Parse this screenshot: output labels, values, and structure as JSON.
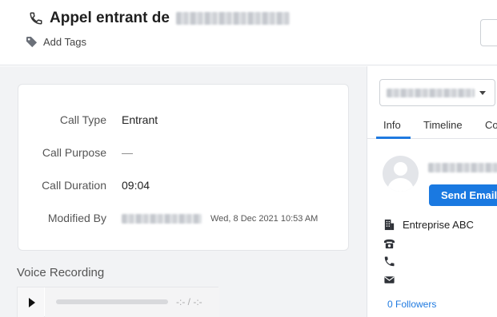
{
  "header": {
    "title": "Appel entrant de",
    "add_tags_label": "Add Tags"
  },
  "details": {
    "fields": [
      {
        "label": "Call Type",
        "value": "Entrant"
      },
      {
        "label": "Call Purpose",
        "value": "—"
      },
      {
        "label": "Call Duration",
        "value": "09:04"
      },
      {
        "label": "Modified By",
        "value": "Wed, 8 Dec 2021 10:53 AM"
      }
    ]
  },
  "voice_recording": {
    "heading": "Voice Recording",
    "time": "-:- / -:-"
  },
  "sidebar": {
    "tabs": [
      "Info",
      "Timeline",
      "Co"
    ],
    "active_tab": "Info",
    "send_email_label": "Send Email",
    "company": "Entreprise ABC",
    "followers": "0 Followers"
  },
  "colors": {
    "accent": "#1f7ae0",
    "button": "#1a79e1",
    "page_bg": "#f2f3f5"
  },
  "icons": {
    "title": "phone-icon",
    "tags": "tag-icon",
    "company": "building-icon",
    "phone": "telephone-icon",
    "mobile": "phone-handset-icon",
    "email": "envelope-icon"
  }
}
